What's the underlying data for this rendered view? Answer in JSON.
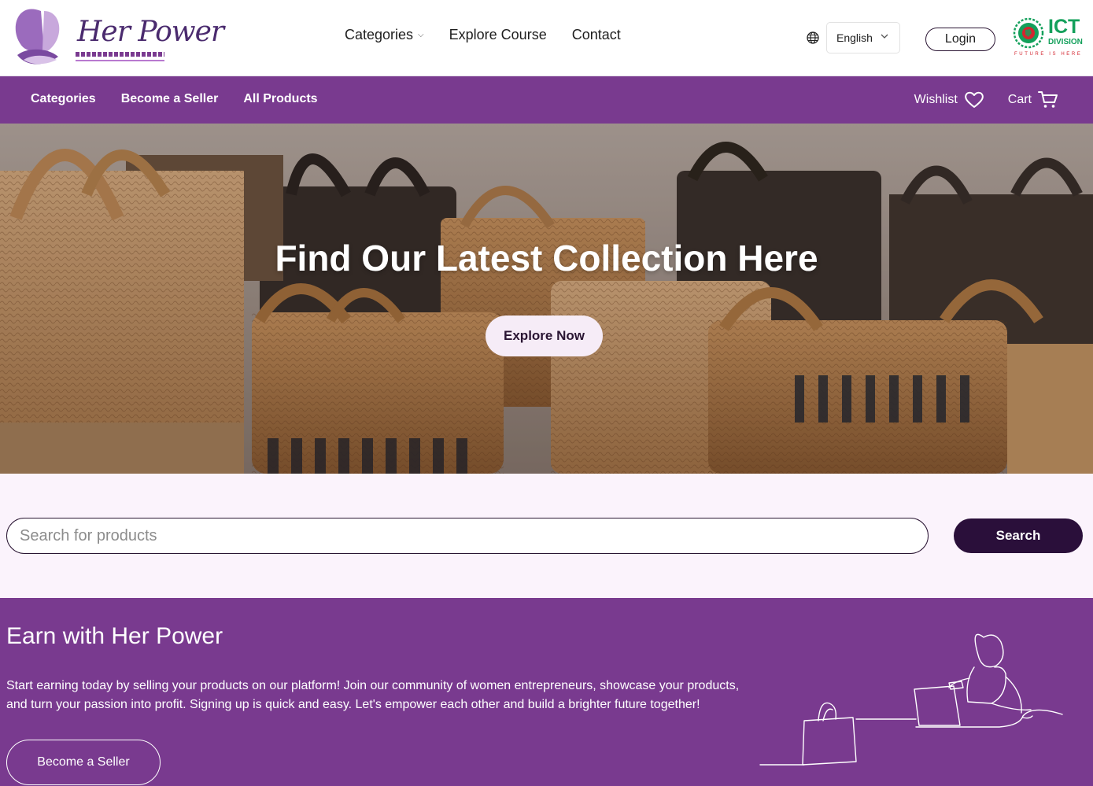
{
  "brand": {
    "name": "Her Power",
    "tagline": "প্রযুক্তির সহায়তায় নারীর ক্ষমতায়ন",
    "primary_color": "#793a8f",
    "dark_color": "#2a0f3a"
  },
  "header": {
    "nav": [
      {
        "label": "Categories",
        "has_dropdown": true
      },
      {
        "label": "Explore Course",
        "has_dropdown": false
      },
      {
        "label": "Contact",
        "has_dropdown": false
      }
    ],
    "language": {
      "selected": "English",
      "icon": "globe-icon"
    },
    "login_label": "Login",
    "partner_logo": {
      "title": "ICT",
      "subtitle": "DIVISION",
      "tagline": "FUTURE IS HERE"
    }
  },
  "subnav": {
    "links": [
      "Categories",
      "Become a Seller",
      "All Products"
    ],
    "wishlist_label": "Wishlist",
    "cart_label": "Cart"
  },
  "hero": {
    "title": "Find Our Latest Collection Here",
    "cta_label": "Explore Now"
  },
  "search": {
    "placeholder": "Search for products",
    "value": "",
    "button_label": "Search"
  },
  "earn": {
    "title": "Earn with Her Power",
    "description": "Start earning today by selling your products on our platform! Join our community of women entrepreneurs, showcase your products, and turn your passion into profit. Signing up is quick and easy. Let's empower each other and build a brighter future together!",
    "button_label": "Become a Seller"
  }
}
